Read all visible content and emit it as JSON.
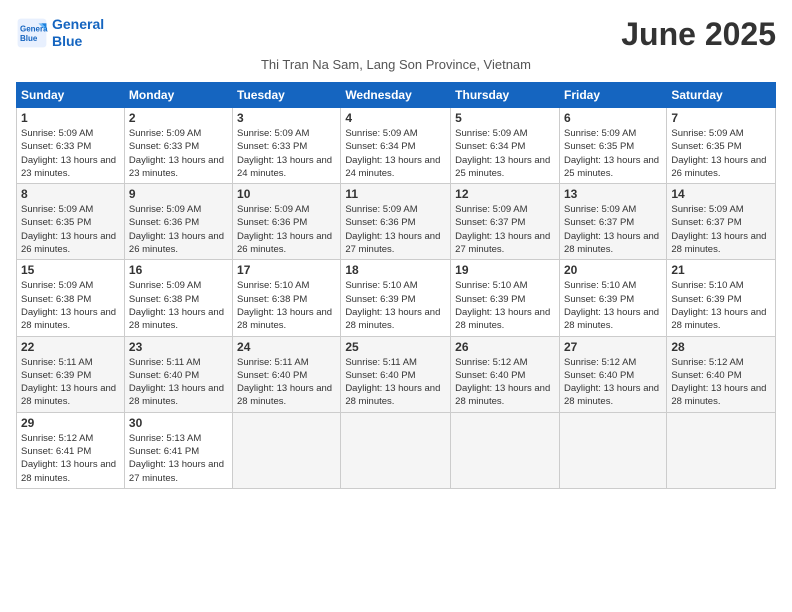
{
  "header": {
    "logo_line1": "General",
    "logo_line2": "Blue",
    "title": "June 2025",
    "subtitle": "Thi Tran Na Sam, Lang Son Province, Vietnam"
  },
  "weekdays": [
    "Sunday",
    "Monday",
    "Tuesday",
    "Wednesday",
    "Thursday",
    "Friday",
    "Saturday"
  ],
  "weeks": [
    [
      {
        "day": "1",
        "sunrise": "5:09 AM",
        "sunset": "6:33 PM",
        "daylight": "13 hours and 23 minutes."
      },
      {
        "day": "2",
        "sunrise": "5:09 AM",
        "sunset": "6:33 PM",
        "daylight": "13 hours and 23 minutes."
      },
      {
        "day": "3",
        "sunrise": "5:09 AM",
        "sunset": "6:33 PM",
        "daylight": "13 hours and 24 minutes."
      },
      {
        "day": "4",
        "sunrise": "5:09 AM",
        "sunset": "6:34 PM",
        "daylight": "13 hours and 24 minutes."
      },
      {
        "day": "5",
        "sunrise": "5:09 AM",
        "sunset": "6:34 PM",
        "daylight": "13 hours and 25 minutes."
      },
      {
        "day": "6",
        "sunrise": "5:09 AM",
        "sunset": "6:35 PM",
        "daylight": "13 hours and 25 minutes."
      },
      {
        "day": "7",
        "sunrise": "5:09 AM",
        "sunset": "6:35 PM",
        "daylight": "13 hours and 26 minutes."
      }
    ],
    [
      {
        "day": "8",
        "sunrise": "5:09 AM",
        "sunset": "6:35 PM",
        "daylight": "13 hours and 26 minutes."
      },
      {
        "day": "9",
        "sunrise": "5:09 AM",
        "sunset": "6:36 PM",
        "daylight": "13 hours and 26 minutes."
      },
      {
        "day": "10",
        "sunrise": "5:09 AM",
        "sunset": "6:36 PM",
        "daylight": "13 hours and 26 minutes."
      },
      {
        "day": "11",
        "sunrise": "5:09 AM",
        "sunset": "6:36 PM",
        "daylight": "13 hours and 27 minutes."
      },
      {
        "day": "12",
        "sunrise": "5:09 AM",
        "sunset": "6:37 PM",
        "daylight": "13 hours and 27 minutes."
      },
      {
        "day": "13",
        "sunrise": "5:09 AM",
        "sunset": "6:37 PM",
        "daylight": "13 hours and 28 minutes."
      },
      {
        "day": "14",
        "sunrise": "5:09 AM",
        "sunset": "6:37 PM",
        "daylight": "13 hours and 28 minutes."
      }
    ],
    [
      {
        "day": "15",
        "sunrise": "5:09 AM",
        "sunset": "6:38 PM",
        "daylight": "13 hours and 28 minutes."
      },
      {
        "day": "16",
        "sunrise": "5:09 AM",
        "sunset": "6:38 PM",
        "daylight": "13 hours and 28 minutes."
      },
      {
        "day": "17",
        "sunrise": "5:10 AM",
        "sunset": "6:38 PM",
        "daylight": "13 hours and 28 minutes."
      },
      {
        "day": "18",
        "sunrise": "5:10 AM",
        "sunset": "6:39 PM",
        "daylight": "13 hours and 28 minutes."
      },
      {
        "day": "19",
        "sunrise": "5:10 AM",
        "sunset": "6:39 PM",
        "daylight": "13 hours and 28 minutes."
      },
      {
        "day": "20",
        "sunrise": "5:10 AM",
        "sunset": "6:39 PM",
        "daylight": "13 hours and 28 minutes."
      },
      {
        "day": "21",
        "sunrise": "5:10 AM",
        "sunset": "6:39 PM",
        "daylight": "13 hours and 28 minutes."
      }
    ],
    [
      {
        "day": "22",
        "sunrise": "5:11 AM",
        "sunset": "6:39 PM",
        "daylight": "13 hours and 28 minutes."
      },
      {
        "day": "23",
        "sunrise": "5:11 AM",
        "sunset": "6:40 PM",
        "daylight": "13 hours and 28 minutes."
      },
      {
        "day": "24",
        "sunrise": "5:11 AM",
        "sunset": "6:40 PM",
        "daylight": "13 hours and 28 minutes."
      },
      {
        "day": "25",
        "sunrise": "5:11 AM",
        "sunset": "6:40 PM",
        "daylight": "13 hours and 28 minutes."
      },
      {
        "day": "26",
        "sunrise": "5:12 AM",
        "sunset": "6:40 PM",
        "daylight": "13 hours and 28 minutes."
      },
      {
        "day": "27",
        "sunrise": "5:12 AM",
        "sunset": "6:40 PM",
        "daylight": "13 hours and 28 minutes."
      },
      {
        "day": "28",
        "sunrise": "5:12 AM",
        "sunset": "6:40 PM",
        "daylight": "13 hours and 28 minutes."
      }
    ],
    [
      {
        "day": "29",
        "sunrise": "5:12 AM",
        "sunset": "6:41 PM",
        "daylight": "13 hours and 28 minutes."
      },
      {
        "day": "30",
        "sunrise": "5:13 AM",
        "sunset": "6:41 PM",
        "daylight": "13 hours and 27 minutes."
      },
      null,
      null,
      null,
      null,
      null
    ]
  ],
  "labels": {
    "sunrise": "Sunrise:",
    "sunset": "Sunset:",
    "daylight": "Daylight:"
  }
}
